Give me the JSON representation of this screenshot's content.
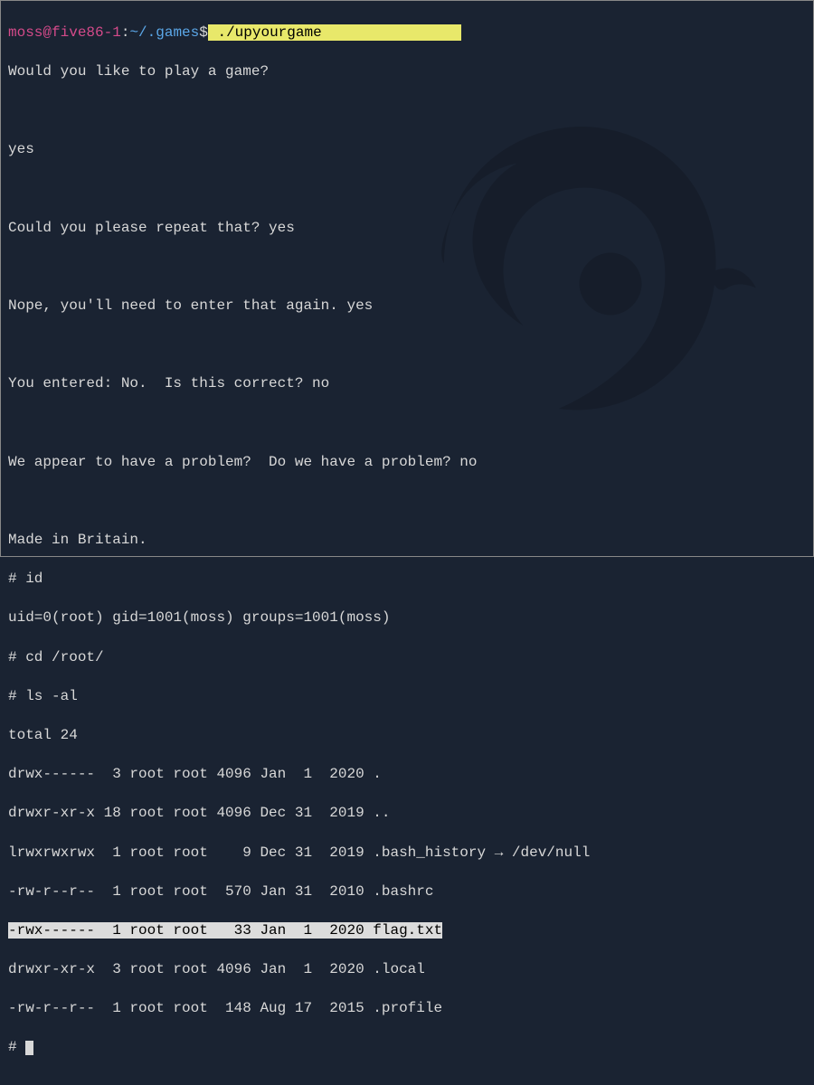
{
  "prompt": {
    "user": "moss",
    "at": "@",
    "host": "five86-1",
    "colon": ":",
    "path": "~/.games",
    "dollar": "$",
    "command": " ./upyourgame                "
  },
  "game": {
    "q1": "Would you like to play a game?",
    "a1": "yes",
    "q2": "Could you please repeat that? yes",
    "q3": "Nope, you'll need to enter that again. yes",
    "q4": "You entered: No.  Is this correct? no",
    "q5": "We appear to have a problem?  Do we have a problem? no",
    "made": "Made in Britain."
  },
  "cmds": {
    "id_cmd": "# id",
    "id_out": "uid=0(root) gid=1001(moss) groups=1001(moss)",
    "cd_cmd": "# cd /root/",
    "ls_cmd": "# ls -al",
    "total": "total 24"
  },
  "ls": {
    "r0": "drwx------  3 root root 4096 Jan  1  2020 .",
    "r1": "drwxr-xr-x 18 root root 4096 Dec 31  2019 ..",
    "r2": "lrwxrwxrwx  1 root root    9 Dec 31  2019 .bash_history → /dev/null",
    "r3": "-rw-r--r--  1 root root  570 Jan 31  2010 .bashrc",
    "r4": "-rwx------  1 root root   33 Jan  1  2020 flag.txt",
    "r5": "drwxr-xr-x  3 root root 4096 Jan  1  2020 .local",
    "r6": "-rw-r--r--  1 root root  148 Aug 17  2015 .profile"
  },
  "end": {
    "hash": "# "
  }
}
